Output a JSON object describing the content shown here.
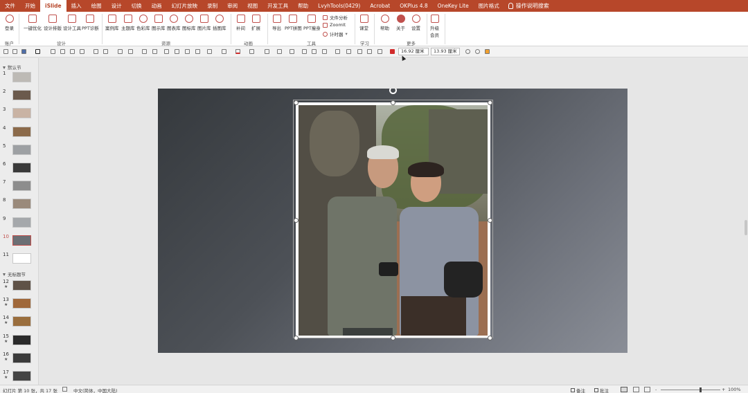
{
  "tabs": [
    {
      "label": "文件"
    },
    {
      "label": "开始"
    },
    {
      "label": "iSlide",
      "active": true
    },
    {
      "label": "插入"
    },
    {
      "label": "绘图"
    },
    {
      "label": "设计"
    },
    {
      "label": "切换"
    },
    {
      "label": "动画"
    },
    {
      "label": "幻灯片放映"
    },
    {
      "label": "录制"
    },
    {
      "label": "审阅"
    },
    {
      "label": "视图"
    },
    {
      "label": "开发工具"
    },
    {
      "label": "帮助"
    },
    {
      "label": "LvyhTools(0429)"
    },
    {
      "label": "Acrobat"
    },
    {
      "label": "OKPlus 4.8"
    },
    {
      "label": "OneKey Lite"
    },
    {
      "label": "图片格式"
    }
  ],
  "search_label": "操作说明搜索",
  "ribbon": {
    "buttons": {
      "login": "登录",
      "one_click": "一键优化",
      "design_layout": "设计排版",
      "design_tools": "设计工具",
      "ppt_diagnose": "PPT诊断",
      "case_lib": "案例库",
      "theme_lib": "主题库",
      "color_lib": "色彩库",
      "diagram_lib": "图示库",
      "chart_lib": "图表库",
      "icon_lib": "图标库",
      "image_lib": "图片库",
      "illus_lib": "插图库",
      "tween": "补间",
      "extend": "扩展",
      "export": "导出",
      "ppt_collage": "PPT拼图",
      "ppt_thin": "PPT瘦身",
      "file_analysis": "文件分析",
      "zoomit": "ZoomIt",
      "timer": "计时器",
      "classroom": "课堂",
      "help": "帮助",
      "about": "关于",
      "settings": "设置",
      "upgrade_l1": "升级",
      "upgrade_l2": "会员"
    },
    "groups": {
      "account": "账户",
      "design": "设计",
      "resources": "资源",
      "animation": "动画",
      "tools": "工具",
      "learn": "学习",
      "more": "更多"
    }
  },
  "format": {
    "height": "16.92 厘米",
    "width": "13.93 厘米"
  },
  "sections": {
    "default": "默认节",
    "untitled": "无标题节"
  },
  "slides": [
    {
      "num": "1",
      "color": "#bdbab5"
    },
    {
      "num": "2",
      "color": "#6b5a4c"
    },
    {
      "num": "3",
      "color": "#c9b3a4"
    },
    {
      "num": "4",
      "color": "#8b6a4a"
    },
    {
      "num": "5",
      "color": "#9da0a3"
    },
    {
      "num": "6",
      "color": "#3a3a3a"
    },
    {
      "num": "7",
      "color": "#8d8d8d"
    },
    {
      "num": "8",
      "color": "#9a8a7b"
    },
    {
      "num": "9",
      "color": "#a5a8ab"
    },
    {
      "num": "10",
      "color": "#6b6f74",
      "active": true
    },
    {
      "num": "11",
      "color": "#ffffff"
    },
    {
      "num": "12",
      "color": "#5f5247"
    },
    {
      "num": "13",
      "color": "#a0683a"
    },
    {
      "num": "14",
      "color": "#9a6e3d"
    },
    {
      "num": "15",
      "color": "#2a2a2a"
    },
    {
      "num": "16",
      "color": "#3b3b3b"
    },
    {
      "num": "17",
      "color": "#434343"
    }
  ],
  "star_glyph": "★",
  "status": {
    "slide_info": "幻灯片 第 10 张，共 17 张",
    "language": "中文(简体，中国大陆)",
    "notes": "备注",
    "comments": "批注",
    "zoom_minus": "-",
    "zoom_plus": "+",
    "zoom": "100%"
  },
  "colors": {
    "accent": "#b7472a",
    "icon_red": "#c0504d"
  }
}
